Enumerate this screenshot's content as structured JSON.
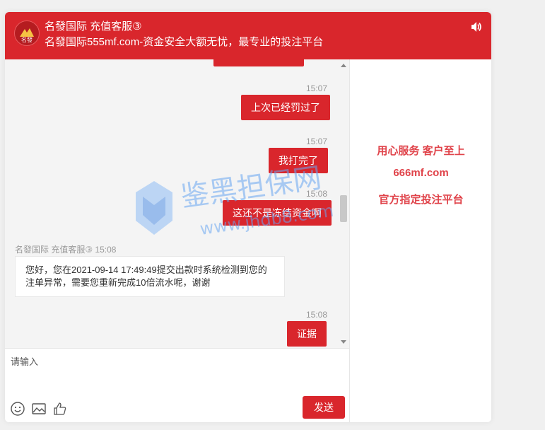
{
  "header": {
    "title": "名發国际 充值客服③",
    "subtitle": "名發国际555mf.com-资金安全大额无忧，最专业的投注平台",
    "logo_text": "名發",
    "sound_icon": "speaker-icon"
  },
  "messages": {
    "m1_time": "15:07",
    "m1_text": "上次已经罚过了",
    "m2_time": "15:07",
    "m2_text": "我打完了",
    "m3_time": "15:08",
    "m3_text": "这还不是冻结资金啊",
    "agent_name": "名發国际 充值客服③ 15:08",
    "agent_text": "您好，您在2021-09-14 17:49:49提交出款时系统检测到您的注单异常，需要您重新完成10倍流水呢，谢谢",
    "m4_time": "15:08",
    "m4_text": "证据"
  },
  "composer": {
    "placeholder": "请输入",
    "send_label": "发送",
    "tools": [
      "emoji-icon",
      "image-icon",
      "thumbs-up-icon"
    ]
  },
  "side": {
    "line1": "用心服务 客户至上",
    "line2": "666mf.com",
    "line3": "官方指定投注平台"
  },
  "watermark": {
    "text": "鉴黑担保网",
    "url": "www.jhdb8.com"
  },
  "colors": {
    "brand_red": "#d9262c",
    "side_text": "#e0434a",
    "watermark_blue": "#5b9bf0"
  }
}
